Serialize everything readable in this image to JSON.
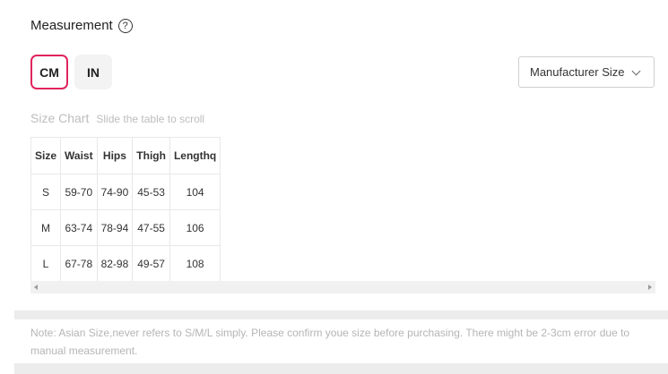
{
  "header": {
    "title": "Measurement",
    "help_icon": "?"
  },
  "units": {
    "selected": "CM",
    "cm_label": "CM",
    "in_label": "IN"
  },
  "size_select": {
    "value": "Manufacturer Size"
  },
  "size_chart": {
    "title": "Size Chart",
    "hint": "Slide the table to scroll",
    "columns": [
      "Size",
      "Waist",
      "Hips",
      "Thigh",
      "Lengthq"
    ],
    "rows": [
      [
        "S",
        "59-70",
        "74-90",
        "45-53",
        "104"
      ],
      [
        "M",
        "63-74",
        "78-94",
        "47-55",
        "106"
      ],
      [
        "L",
        "67-78",
        "82-98",
        "49-57",
        "108"
      ]
    ]
  },
  "note": "Note: Asian Size,never refers to S/M/L simply. Please confirm youe size before purchasing. There might be 2-3cm error due to manual measurement.",
  "colors": {
    "accent": "#e0245e",
    "muted_text": "#bdbdbd",
    "divider": "#ececec"
  }
}
